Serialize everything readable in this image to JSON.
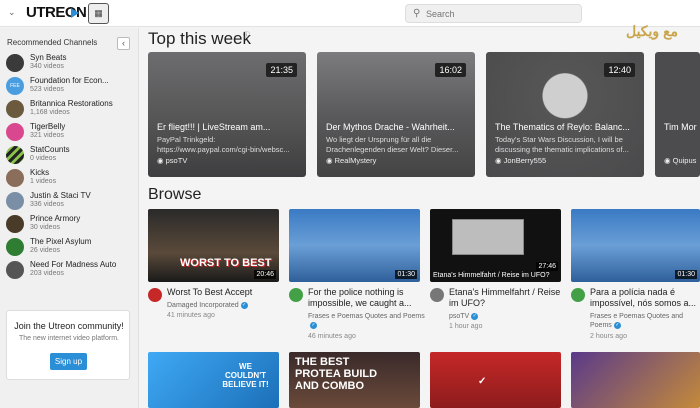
{
  "header": {
    "logo": "UTREON",
    "search_placeholder": "Search",
    "watermark": "مع ويكيل"
  },
  "sidebar": {
    "title": "Recommended Channels",
    "channels": [
      {
        "name": "Syn Beats",
        "count": "340 videos",
        "color": "#3a3a3a"
      },
      {
        "name": "Foundation for Econ...",
        "count": "523 videos",
        "color": "#4a9ee0"
      },
      {
        "name": "Britannica Restorations",
        "count": "1,168 videos",
        "color": "#6b5a3e"
      },
      {
        "name": "TigerBelly",
        "count": "321 videos",
        "color": "#d9478e"
      },
      {
        "name": "StatCounts",
        "count": "0 videos",
        "color": "#8bc34a"
      },
      {
        "name": "Kicks",
        "count": "1 videos",
        "color": "#8a6d5a"
      },
      {
        "name": "Justin & Staci TV",
        "count": "336 videos",
        "color": "#7a8fa6"
      },
      {
        "name": "Prince Armory",
        "count": "30 videos",
        "color": "#4a3a28"
      },
      {
        "name": "The Pixel Asylum",
        "count": "26 videos",
        "color": "#2e7d32"
      },
      {
        "name": "Need For Madness Auto",
        "count": "203 videos",
        "color": "#555555"
      }
    ],
    "community": {
      "title": "Join the Utreon community!",
      "subtitle": "The new internet video platform.",
      "button": "Sign up"
    }
  },
  "top": {
    "title": "Top this week",
    "info_icon": "ⓘ",
    "cards": [
      {
        "duration": "21:35",
        "title": "Er fliegt!!! | LiveStream am...",
        "desc": "PayPal Trinkgeld: https://www.paypal.com/cgi-bin/websc...",
        "channel": "psoTV"
      },
      {
        "duration": "16:02",
        "title": "Der Mythos Drache - Wahrheit...",
        "desc": "Wo liegt der Ursprung für all die Drachenlegenden dieser Welt? Dieser...",
        "channel": "RealMystery"
      },
      {
        "duration": "12:40",
        "title": "The Thematics of Reylo: Balanc...",
        "desc": "Today's Star Wars Discussion, I will be discussing the thematic implications of...",
        "channel": "JonBerry555"
      },
      {
        "duration": "",
        "title": "Tim Mor",
        "desc": "",
        "channel": "Quipus"
      }
    ]
  },
  "browse": {
    "title": "Browse",
    "videos": [
      {
        "duration": "20:46",
        "overlay": "WORST TO BEST",
        "title": "Worst To Best Accept",
        "channel": "Damaged Incorporated",
        "time": "41 minutes ago",
        "avatar": "#c62828"
      },
      {
        "duration": "01:30",
        "overlay": "",
        "title": "For the police nothing is impossible, we caught a...",
        "channel": "Frases e Poemas Quotes and Poems",
        "time": "46 minutes ago",
        "avatar": "#43a047"
      },
      {
        "duration": "27:46",
        "overlay": "Etana's Himmelfahrt / Reise im UFO?",
        "title": "Etana's Himmelfahrt / Reise im UFO?",
        "channel": "psoTV",
        "time": "1 hour ago",
        "avatar": "#777777"
      },
      {
        "duration": "01:30",
        "overlay": "",
        "title": "Para a polícia nada é impossível, nós somos a...",
        "channel": "Frases e Poemas Quotes and Poems",
        "time": "2 hours ago",
        "avatar": "#43a047"
      }
    ],
    "row2": [
      {
        "overlay": "WE COULDN'T BELIEVE IT!"
      },
      {
        "overlay": "THE BEST PROTEA BUILD AND COMBO"
      },
      {
        "overlay": ""
      },
      {
        "overlay": ""
      }
    ]
  }
}
